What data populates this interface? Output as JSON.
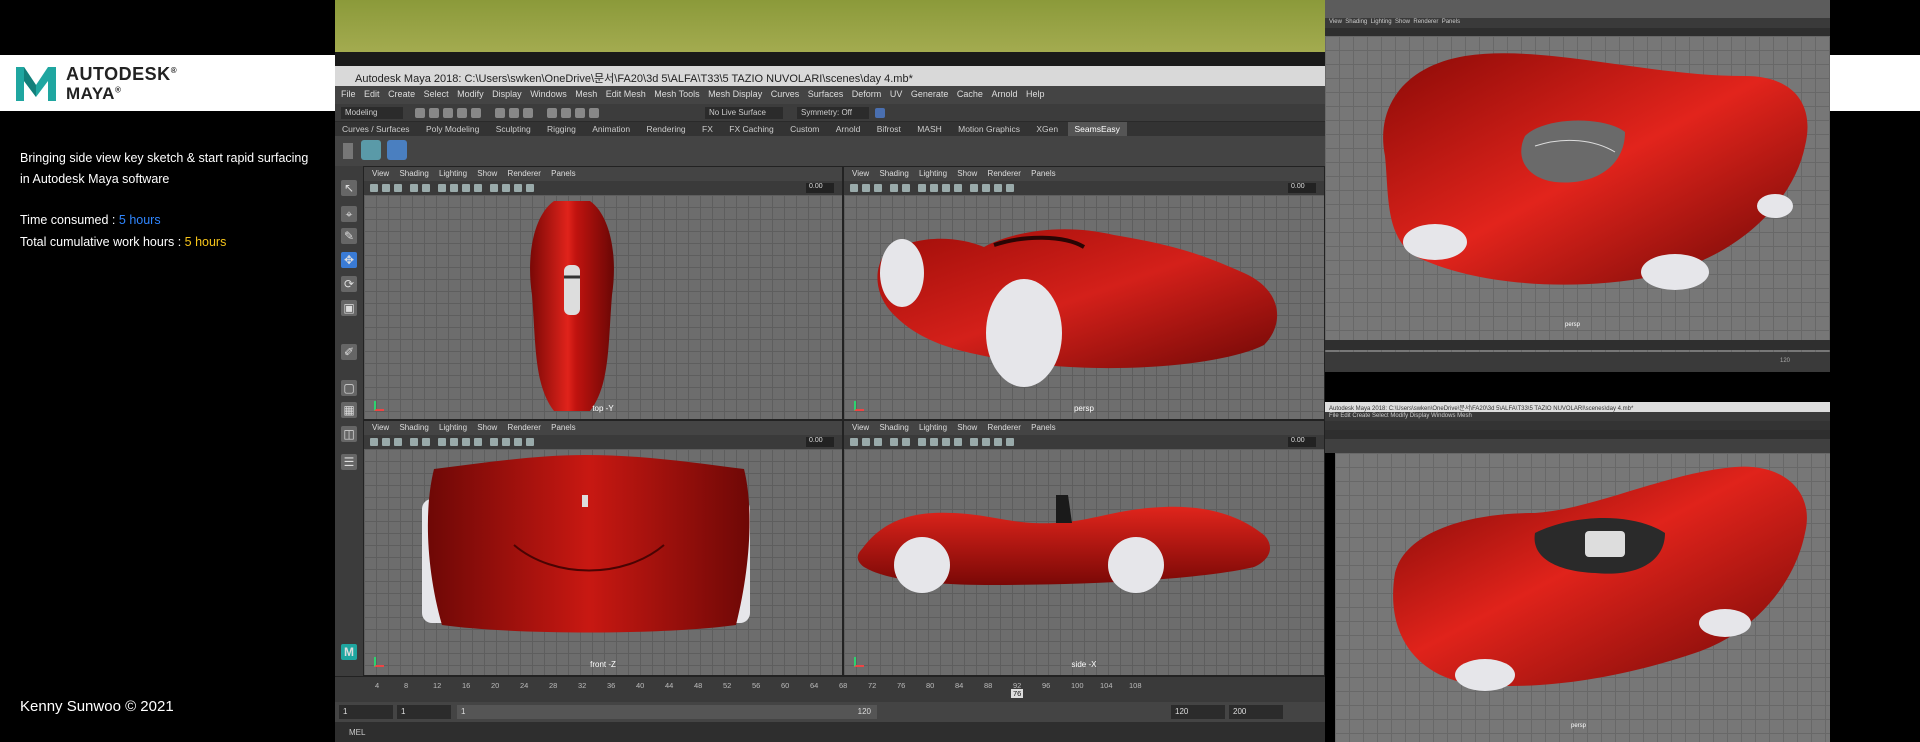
{
  "brand": {
    "line1": "AUTODESK",
    "line2": "MAYA",
    "reg": "®"
  },
  "info": {
    "desc1": "Bringing side view key sketch & start rapid surfacing",
    "desc2": "in Autodesk Maya software",
    "time_label": "Time consumed : ",
    "time_value": "5 hours",
    "total_label": "Total cumulative work hours : ",
    "total_value": "5 hours"
  },
  "credit": "Kenny Sunwoo © 2021",
  "maya": {
    "title": "Autodesk Maya 2018: C:\\Users\\swken\\OneDrive\\문서\\FA20\\3d 5\\ALFA\\T33\\5 TAZIO NUVOLARI\\scenes\\day 4.mb*",
    "menus": [
      "File",
      "Edit",
      "Create",
      "Select",
      "Modify",
      "Display",
      "Windows",
      "Mesh",
      "Edit Mesh",
      "Mesh Tools",
      "Mesh Display",
      "Curves",
      "Surfaces",
      "Deform",
      "UV",
      "Generate",
      "Cache",
      "Arnold",
      "Help"
    ],
    "mode": "Modeling",
    "live_surface": "No Live Surface",
    "symmetry": "Symmetry: Off",
    "shelf_tabs": [
      "Curves / Surfaces",
      "Poly Modeling",
      "Sculpting",
      "Rigging",
      "Animation",
      "Rendering",
      "FX",
      "FX Caching",
      "Custom",
      "Arnold",
      "Bifrost",
      "MASH",
      "Motion Graphics",
      "XGen",
      "SeamsEasy"
    ],
    "active_shelf_tab": "SeamsEasy",
    "viewport_menu": [
      "View",
      "Shading",
      "Lighting",
      "Show",
      "Renderer",
      "Panels"
    ],
    "viewport_value": "0.00",
    "viewports": [
      {
        "name": "top -Y"
      },
      {
        "name": "persp"
      },
      {
        "name": "front -Z"
      },
      {
        "name": "side -X"
      }
    ],
    "timeline_ticks": [
      "4",
      "8",
      "12",
      "16",
      "20",
      "24",
      "28",
      "32",
      "36",
      "40",
      "44",
      "48",
      "52",
      "56",
      "60",
      "64",
      "68",
      "72",
      "76",
      "80",
      "84",
      "88",
      "92",
      "96",
      "100",
      "104",
      "108"
    ],
    "current_frame": "76",
    "range": {
      "start": "1",
      "start2": "1",
      "slider_start": "1",
      "slider_end": "120",
      "end": "120",
      "end2": "200"
    },
    "command_label": "MEL"
  },
  "photos": {
    "top_label": "persp",
    "top_frame": "120",
    "bottom_label": "persp"
  },
  "colors": {
    "car_red": "#c0130f",
    "wheel": "#e6e6ea",
    "accent_blue": "#2f86ff",
    "accent_yellow": "#f7c51a"
  }
}
